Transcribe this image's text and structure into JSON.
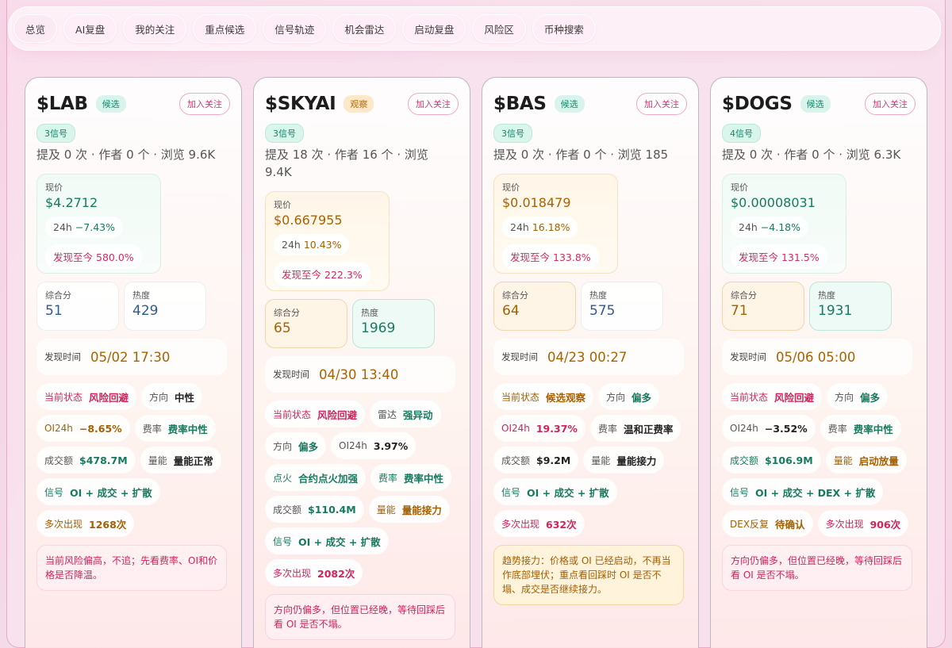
{
  "tabs": [
    "总览",
    "AI复盘",
    "我的关注",
    "重点候选",
    "信号轨迹",
    "机会雷达",
    "启动复盘",
    "风险区",
    "币种搜索"
  ],
  "follow_label": "加入关注",
  "labels": {
    "price": "现价",
    "change24h": "24h",
    "since_discovery": "发现至今",
    "score": "综合分",
    "heat": "热度",
    "discovered_at": "发现时间"
  },
  "cards": [
    {
      "symbol": "$LAB",
      "status": "候选",
      "signals": "3信号",
      "meta": "提及 0 次 · 作者 0 个 · 浏览 9.6K",
      "price": "$4.2712",
      "change": "−7.43%",
      "since": "580.0%",
      "score": "51",
      "heat": "429",
      "discovered": "05/02 17:30",
      "chips": [
        {
          "label": "当前状态",
          "value": "风险回避"
        },
        {
          "label": "方向",
          "value": "中性"
        },
        {
          "label": "OI24h",
          "value": "−8.65%"
        },
        {
          "label": "费率",
          "value": "费率中性"
        },
        {
          "label": "成交额",
          "value": "$478.7M"
        },
        {
          "label": "量能",
          "value": "量能正常"
        },
        {
          "label": "信号",
          "value": "OI + 成交 + 扩散"
        },
        {
          "label": "多次出现",
          "value": "1268次"
        }
      ],
      "note": "当前风险偏高，不追；先看费率、OI和价格是否降温。"
    },
    {
      "symbol": "$SKYAI",
      "status": "观察",
      "signals": "3信号",
      "meta": "提及 18 次 · 作者 16 个 · 浏览 9.4K",
      "price": "$0.667955",
      "change": "10.43%",
      "since": "222.3%",
      "score": "65",
      "heat": "1969",
      "discovered": "04/30 13:40",
      "chips": [
        {
          "label": "当前状态",
          "value": "风险回避"
        },
        {
          "label": "雷达",
          "value": "强异动"
        },
        {
          "label": "方向",
          "value": "偏多"
        },
        {
          "label": "OI24h",
          "value": "3.97%"
        },
        {
          "label": "点火",
          "value": "合约点火加强"
        },
        {
          "label": "费率",
          "value": "费率中性"
        },
        {
          "label": "成交额",
          "value": "$110.4M"
        },
        {
          "label": "量能",
          "value": "量能接力"
        },
        {
          "label": "信号",
          "value": "OI + 成交 + 扩散"
        },
        {
          "label": "多次出现",
          "value": "2082次"
        }
      ],
      "note": "方向仍偏多，但位置已经晚，等待回踩后看 OI 是否不塌。"
    },
    {
      "symbol": "$BAS",
      "status": "候选",
      "signals": "3信号",
      "meta": "提及 0 次 · 作者 0 个 · 浏览 185",
      "price": "$0.018479",
      "change": "16.18%",
      "since": "133.8%",
      "score": "64",
      "heat": "575",
      "discovered": "04/23 00:27",
      "chips": [
        {
          "label": "当前状态",
          "value": "候选观察"
        },
        {
          "label": "方向",
          "value": "偏多"
        },
        {
          "label": "OI24h",
          "value": "19.37%"
        },
        {
          "label": "费率",
          "value": "温和正费率"
        },
        {
          "label": "成交额",
          "value": "$9.2M"
        },
        {
          "label": "量能",
          "value": "量能接力"
        },
        {
          "label": "信号",
          "value": "OI + 成交 + 扩散"
        },
        {
          "label": "多次出现",
          "value": "632次"
        }
      ],
      "note": "趋势接力：价格或 OI 已经启动，不再当作底部埋伏；重点看回踩时 OI 是否不塌、成交是否继续接力。"
    },
    {
      "symbol": "$DOGS",
      "status": "候选",
      "signals": "4信号",
      "meta": "提及 0 次 · 作者 0 个 · 浏览 6.3K",
      "price": "$0.00008031",
      "change": "−4.18%",
      "since": "131.5%",
      "score": "71",
      "heat": "1931",
      "discovered": "05/06 05:00",
      "chips": [
        {
          "label": "当前状态",
          "value": "风险回避"
        },
        {
          "label": "方向",
          "value": "偏多"
        },
        {
          "label": "OI24h",
          "value": "−3.52%"
        },
        {
          "label": "费率",
          "value": "费率中性"
        },
        {
          "label": "成交额",
          "value": "$106.9M"
        },
        {
          "label": "量能",
          "value": "启动放量"
        },
        {
          "label": "信号",
          "value": "OI + 成交 + DEX + 扩散"
        },
        {
          "label": "DEX反复",
          "value": "待确认"
        },
        {
          "label": "多次出现",
          "value": "906次"
        }
      ],
      "note": "方向仍偏多，但位置已经晚，等待回踩后看 OI 是否不塌。"
    }
  ]
}
